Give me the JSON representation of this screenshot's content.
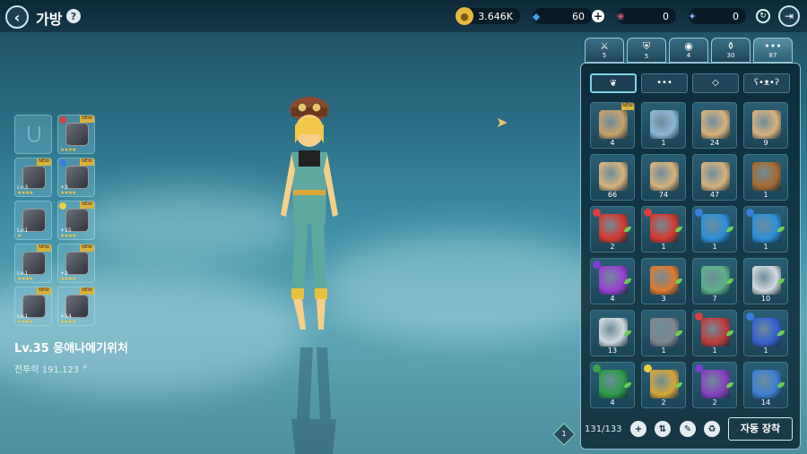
{
  "header": {
    "title": "가방",
    "help": "?",
    "back_icon": "back-arrow-icon",
    "exit_icon": "exit-icon"
  },
  "currencies": [
    {
      "name": "gold",
      "value": "3.646K",
      "icon": "gold-coin-icon",
      "color": "#e6b83d"
    },
    {
      "name": "gem",
      "value": "60",
      "icon": "blue-gem-icon",
      "color": "#3fa0e6"
    },
    {
      "name": "ticket",
      "value": "0",
      "icon": "ticket-icon",
      "color": "#d45d7a"
    },
    {
      "name": "crystal",
      "value": "0",
      "icon": "crystal-icon",
      "color": "#7fb7ff"
    }
  ],
  "plus": "+",
  "character": {
    "name": "Lv.35 응애나에기위처",
    "power_label": "전투력",
    "power": "191.123"
  },
  "equipment": [
    {
      "type": "necklace",
      "empty": true
    },
    {
      "type": "sword",
      "lv": "",
      "stars": "★★★★",
      "new": "NEW",
      "gem": "#d94040"
    },
    {
      "type": "goggles",
      "lv": "Lv.3",
      "stars": "★★★★",
      "new": "NEW"
    },
    {
      "type": "spear",
      "lv": "+2",
      "stars": "★★★★",
      "new": "NEW",
      "gem": "#3a7fd9"
    },
    {
      "type": "chain",
      "lv": "Lv.1",
      "stars": "★",
      "new": ""
    },
    {
      "type": "dagger",
      "lv": "+15",
      "stars": "★★★★",
      "new": "NEW",
      "gem": "#e8d040"
    },
    {
      "type": "helmet",
      "lv": "Lv.1",
      "stars": "★★★★",
      "new": "NEW"
    },
    {
      "type": "armor",
      "lv": "+2",
      "stars": "★★★★",
      "new": "NEW"
    },
    {
      "type": "gloves",
      "lv": "Lv.1",
      "stars": "★★★★",
      "new": "NEW"
    },
    {
      "type": "boots",
      "lv": "+14",
      "stars": "★★★★",
      "new": "NEW"
    }
  ],
  "tabs": [
    {
      "icon": "sword-icon",
      "count": "5"
    },
    {
      "icon": "shield-icon",
      "count": "5"
    },
    {
      "icon": "orb-icon",
      "count": "4"
    },
    {
      "icon": "potion-icon",
      "count": "30"
    },
    {
      "icon": "more-icon",
      "count": "87"
    }
  ],
  "filters": [
    {
      "icon": "sprout-icon",
      "label": "❦"
    },
    {
      "icon": "ellipsis-icon",
      "label": "•••"
    },
    {
      "icon": "diamond-icon",
      "label": "◇"
    },
    {
      "icon": "bear-icon",
      "label": "ʕ•ᴥ•ʔ"
    }
  ],
  "items": [
    {
      "name": "scroll-wings",
      "count": "4",
      "color": "#c9a06a",
      "badge": "NEW"
    },
    {
      "name": "spellbook",
      "count": "1",
      "color": "#8fb6d6"
    },
    {
      "name": "scroll-red",
      "count": "24",
      "color": "#d8b27c"
    },
    {
      "name": "scroll-red-2",
      "count": "9",
      "color": "#d8b27c"
    },
    {
      "name": "scroll-green",
      "count": "66",
      "color": "#d8b27c"
    },
    {
      "name": "scroll-gold",
      "count": "74",
      "color": "#d8b27c"
    },
    {
      "name": "scroll-purple",
      "count": "47",
      "color": "#d8b27c"
    },
    {
      "name": "sack",
      "count": "1",
      "color": "#a86a2f"
    },
    {
      "name": "red-stone",
      "count": "2",
      "color": "#d6392f",
      "gem": "#d94040"
    },
    {
      "name": "red-shard",
      "count": "1",
      "color": "#d6392f",
      "gem": "#d94040"
    },
    {
      "name": "blue-stone",
      "count": "1",
      "color": "#2e8fd8",
      "gem": "#3a7fd9"
    },
    {
      "name": "blue-shard",
      "count": "1",
      "color": "#2e8fd8",
      "gem": "#3a7fd9"
    },
    {
      "name": "purple-stone",
      "count": "4",
      "color": "#9a3fd0",
      "gem": "#7a3fd0"
    },
    {
      "name": "rainbow-stone",
      "count": "3",
      "color": "#e07a2f"
    },
    {
      "name": "rainbow-shard",
      "count": "7",
      "color": "#5fb08a"
    },
    {
      "name": "silver-stone",
      "count": "10",
      "color": "#cfd8de"
    },
    {
      "name": "silver-stone-2",
      "count": "13",
      "color": "#cfd8de"
    },
    {
      "name": "anvil",
      "count": "1",
      "color": "#7d8790"
    },
    {
      "name": "red-potion",
      "count": "1",
      "color": "#c23b3b",
      "gem": "#d94040"
    },
    {
      "name": "blue-potion",
      "count": "1",
      "color": "#3a5fd0",
      "gem": "#3a7fd9"
    },
    {
      "name": "green-potion",
      "count": "4",
      "color": "#2f9a4a",
      "gem": "#3fa04f"
    },
    {
      "name": "gold-potion",
      "count": "2",
      "color": "#d8a63a",
      "gem": "#e8d040"
    },
    {
      "name": "purple-potion",
      "count": "2",
      "color": "#8a3fc0",
      "gem": "#7a3fd0"
    },
    {
      "name": "rainbow-potion",
      "count": "14",
      "color": "#3f7fd0"
    }
  ],
  "bottom": {
    "capacity": "131/133",
    "auto_equip": "자동 장착",
    "page": "1"
  }
}
